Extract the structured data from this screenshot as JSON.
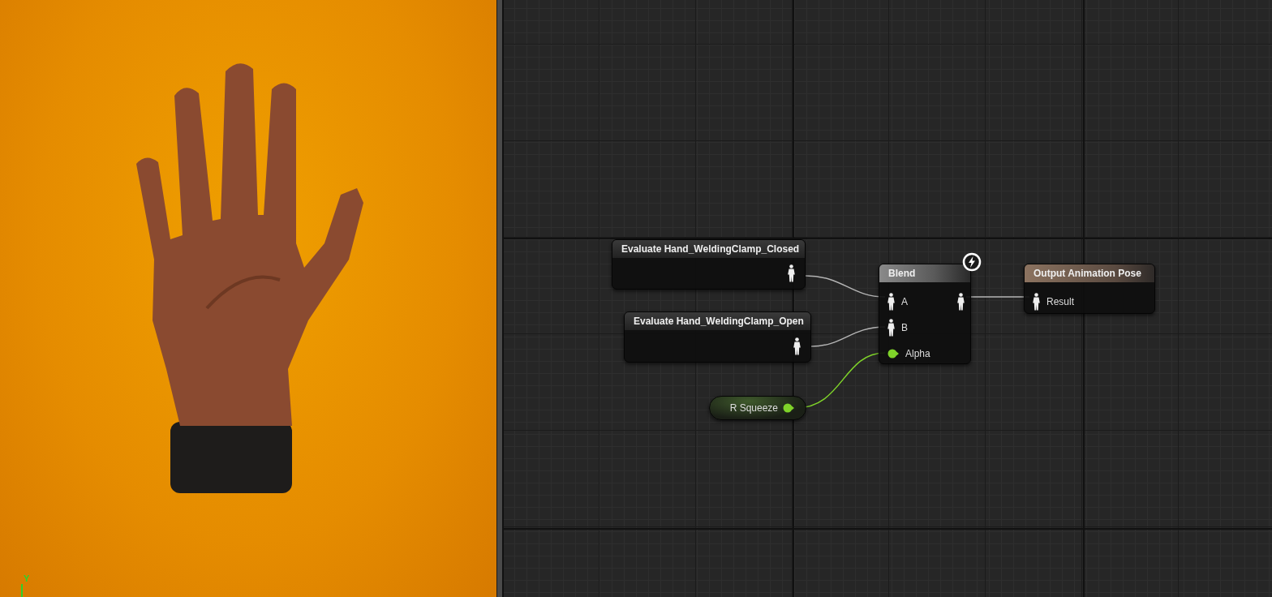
{
  "viewport": {
    "axis_label": "Y"
  },
  "graph": {
    "nodes": [
      {
        "kind": "evaluate",
        "title": "Evaluate Hand_WeldingClamp_Closed"
      },
      {
        "kind": "evaluate",
        "title": "Evaluate Hand_WeldingClamp_Open"
      },
      {
        "kind": "blend",
        "title": "Blend",
        "inputs": [
          {
            "kind": "pose",
            "label": "A"
          },
          {
            "kind": "pose",
            "label": "B"
          },
          {
            "kind": "float",
            "label": "Alpha"
          }
        ]
      },
      {
        "kind": "output",
        "title": "Output Animation Pose",
        "inputs": [
          {
            "kind": "pose",
            "label": "Result"
          }
        ]
      },
      {
        "kind": "variable",
        "title": "R Squeeze"
      }
    ]
  }
}
